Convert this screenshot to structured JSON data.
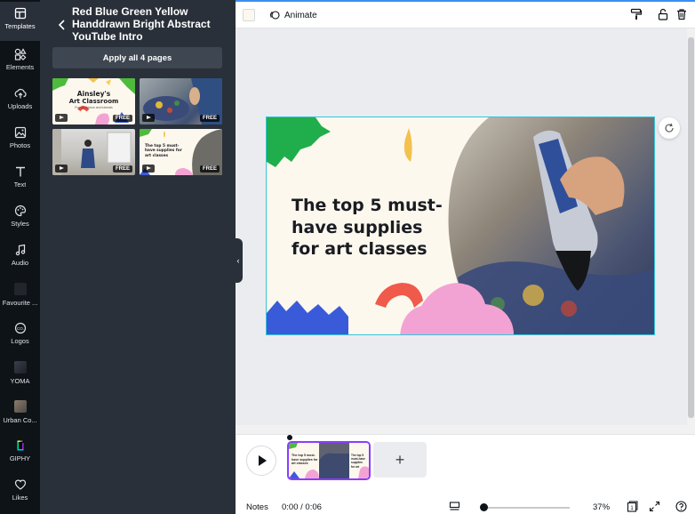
{
  "rail": {
    "items": [
      {
        "label": "Templates",
        "icon": "templates-icon"
      },
      {
        "label": "Elements",
        "icon": "elements-icon"
      },
      {
        "label": "Uploads",
        "icon": "upload-icon"
      },
      {
        "label": "Photos",
        "icon": "photos-icon"
      },
      {
        "label": "Text",
        "icon": "text-icon"
      },
      {
        "label": "Styles",
        "icon": "palette-icon"
      },
      {
        "label": "Audio",
        "icon": "music-note-icon"
      },
      {
        "label": "Favourite ...",
        "icon": "favourite-thumb"
      },
      {
        "label": "Logos",
        "icon": "logos-icon"
      },
      {
        "label": "YOMA",
        "icon": "yoma-thumb"
      },
      {
        "label": "Urban Co...",
        "icon": "urban-thumb"
      },
      {
        "label": "GIPHY",
        "icon": "giphy-icon"
      },
      {
        "label": "Likes",
        "icon": "heart-icon"
      }
    ]
  },
  "panel": {
    "title": "Red Blue Green Yellow Handdrawn Bright Abstract YouTube Intro",
    "apply_label": "Apply all 4 pages",
    "templates": [
      {
        "title": "Ainsley's",
        "title2": "Art Classroom",
        "caption": "Fun art demos and tutorials",
        "badge": "FREE"
      },
      {
        "badge": "FREE"
      },
      {
        "badge": "FREE"
      },
      {
        "title": "The top 5 must-have supplies for art classes",
        "badge": "FREE"
      }
    ]
  },
  "toolbar": {
    "animate_label": "Animate"
  },
  "canvas": {
    "headline": "The top 5 must-have supplies for art classes"
  },
  "timeline": {
    "notes_label": "Notes",
    "time": "0:00 / 0:06",
    "zoom": "37%",
    "page_count": "1",
    "zoom_level": 0.37,
    "add_label": "+",
    "scene_text": "The top 5 must-have supplies for art classes"
  },
  "colors": {
    "accent": "#8b3dff",
    "selection": "#35c5d8",
    "rail_bg": "#0e1318",
    "panel_bg": "#293039",
    "slide_bg": "#fdf8ee"
  }
}
